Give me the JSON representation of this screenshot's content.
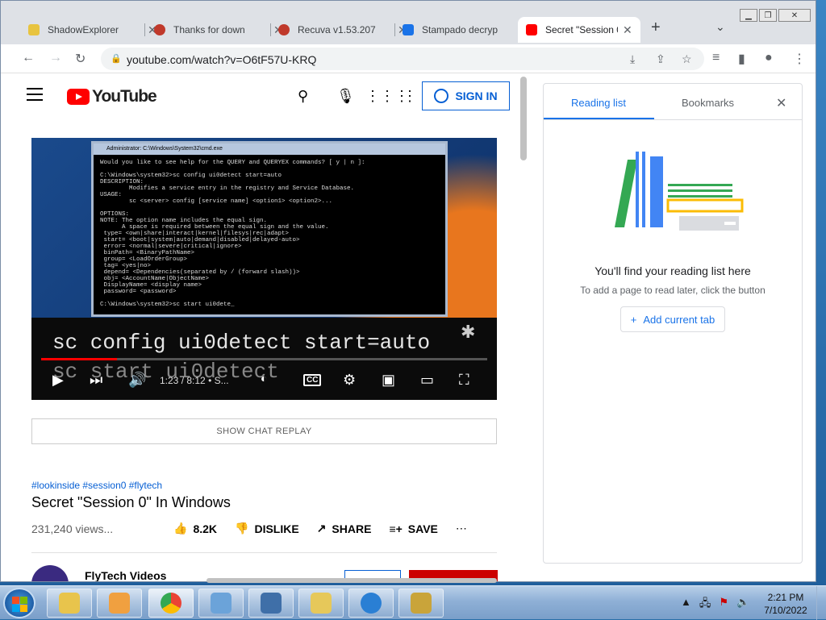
{
  "tabs": [
    {
      "title": "ShadowExplorer",
      "color": "#e8c440"
    },
    {
      "title": "Thanks for down",
      "color": "#c0392b"
    },
    {
      "title": "Recuva v1.53.207",
      "color": "#c0392b"
    },
    {
      "title": "Stampado decryp",
      "color": "#1a73e8"
    },
    {
      "title": "Secret \"Session 0",
      "color": "#ff0000"
    }
  ],
  "toolbar": {
    "url": "youtube.com/watch?v=O6tF57U-KRQ"
  },
  "youtube": {
    "logo_text": "YouTube",
    "sign_in": "SIGN IN"
  },
  "video": {
    "cmd_title": "Administrator: C:\\Windows\\System32\\cmd.exe",
    "cmd_text": "Would you like to see help for the QUERY and QUERYEX commands? [ y | n ]:\n\nC:\\Windows\\system32>sc config ui0detect start=auto\nDESCRIPTION:\n        Modifies a service entry in the registry and Service Database.\nUSAGE:\n        sc <server> config [service name] <option1> <option2>...\n\nOPTIONS:\nNOTE: The option name includes the equal sign.\n      A space is required between the equal sign and the value.\n type= <own|share|interact|kernel|filesys|rec|adapt>\n start= <boot|system|auto|demand|disabled|delayed-auto>\n error= <normal|severe|critical|ignore>\n binPath= <BinaryPathName>\n group= <LoadOrderGroup>\n tag= <yes|no>\n depend= <Dependencies(separated by / (forward slash))>\n obj= <AccountName|ObjectName>\n DisplayName= <display name>\n password= <password>\n\nC:\\Windows\\system32>sc start ui0dete_",
    "caption_1": "sc config ui0detect start=auto",
    "caption_2": "sc start ui0detect",
    "time": "1:23 / 8:12",
    "chapter": "• S...",
    "progress": 0.17
  },
  "chat_replay": "SHOW CHAT REPLAY",
  "hashtags": "#lookinside #session0 #flytech",
  "title": "Secret \"Session 0\" In Windows",
  "views": "231,240 views...",
  "actions": {
    "like_count": "8.2K",
    "dislike": "DISLIKE",
    "share": "SHARE",
    "save": "SAVE"
  },
  "channel": {
    "name": "FlyTech Videos"
  },
  "side_panel": {
    "tab_reading": "Reading list",
    "tab_bookmarks": "Bookmarks",
    "heading": "You'll find your reading list here",
    "subtext": "To add a page to read later, click the button",
    "add_button": "Add current tab"
  },
  "taskbar": {
    "time": "2:21 PM",
    "date": "7/10/2022"
  }
}
